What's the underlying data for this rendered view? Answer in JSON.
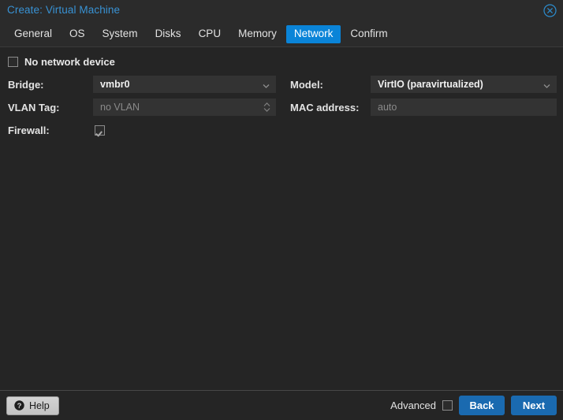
{
  "window": {
    "title": "Create: Virtual Machine",
    "close_icon": "close-circle-icon",
    "accent_blue": "#0a84d8",
    "title_blue": "#3892d4",
    "button_blue": "#1a6ab0",
    "field_bg": "#333333",
    "body_bg": "#252525",
    "header_bg": "#2b2b2b"
  },
  "tabs": [
    {
      "label": "General",
      "active": false
    },
    {
      "label": "OS",
      "active": false
    },
    {
      "label": "System",
      "active": false
    },
    {
      "label": "Disks",
      "active": false
    },
    {
      "label": "CPU",
      "active": false
    },
    {
      "label": "Memory",
      "active": false
    },
    {
      "label": "Network",
      "active": true
    },
    {
      "label": "Confirm",
      "active": false
    }
  ],
  "form": {
    "no_network_device": {
      "label": "No network device",
      "checked": false
    },
    "left": {
      "bridge": {
        "label": "Bridge:",
        "value": "vmbr0",
        "icon": "chevron-down-icon"
      },
      "vlan_tag": {
        "label": "VLAN Tag:",
        "value": "",
        "placeholder": "no VLAN",
        "icon": "spinner-updown-icon"
      },
      "firewall": {
        "label": "Firewall:",
        "checked": true
      }
    },
    "right": {
      "model": {
        "label": "Model:",
        "value": "VirtIO (paravirtualized)",
        "icon": "chevron-down-icon"
      },
      "mac_address": {
        "label": "MAC address:",
        "value": "",
        "placeholder": "auto"
      }
    }
  },
  "footer": {
    "help": {
      "label": "Help",
      "icon": "question-mark-circle-icon"
    },
    "advanced": {
      "label": "Advanced",
      "checked": false
    },
    "back_label": "Back",
    "next_label": "Next"
  }
}
